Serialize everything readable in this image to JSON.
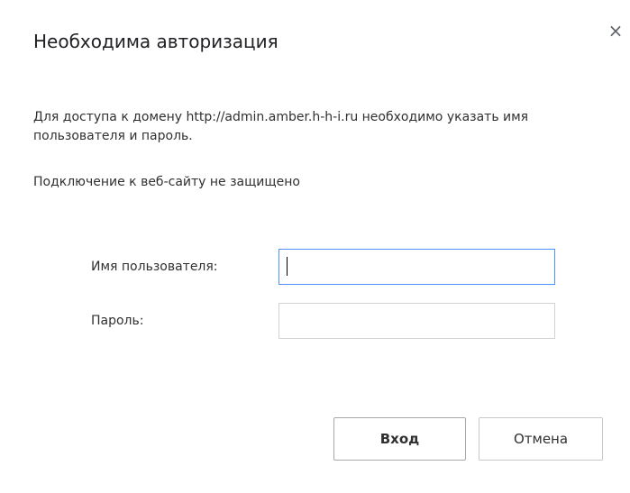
{
  "dialog": {
    "title": "Необходима авторизация",
    "close_symbol": "×",
    "description": "Для доступа к домену http://admin.amber.h-h-i.ru необходимо указать имя пользователя и пароль.",
    "connection_note": "Подключение к веб-сайту не защищено",
    "fields": {
      "username_label": "Имя пользователя:",
      "username_value": "",
      "password_label": "Пароль:",
      "password_value": ""
    },
    "buttons": {
      "login_label": "Вход",
      "cancel_label": "Отмена"
    }
  },
  "colors": {
    "focus_border": "#4d90fe",
    "background": "#ffffff"
  },
  "icons": {
    "close": "close-icon"
  }
}
